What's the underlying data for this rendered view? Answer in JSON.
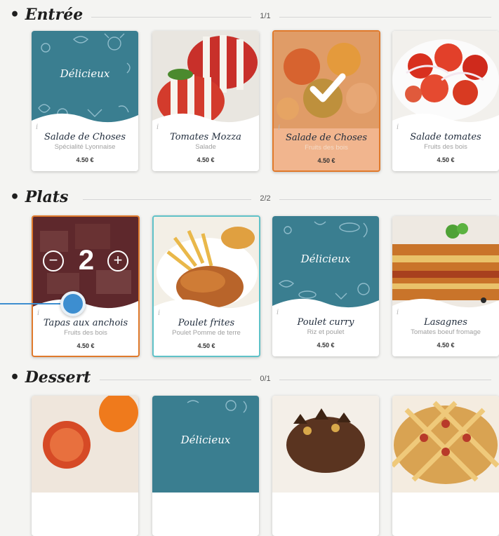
{
  "sections": [
    {
      "title": "• Entrée",
      "count": "1/1",
      "items": [
        {
          "name": "Salade de Choses",
          "sub": "Spécialité Lyonnaise",
          "price": "4.50 €",
          "image": "delicieux"
        },
        {
          "name": "Tomates Mozza",
          "sub": "Salade",
          "price": "4.50 €",
          "image": "tomato-mozza-photo"
        },
        {
          "name": "Salade de Choses",
          "sub": "Fruits des bois",
          "price": "4.50 €",
          "image": "salad-photo",
          "selected": true
        },
        {
          "name": "Salade tomates",
          "sub": "Fruits des bois",
          "price": "4.50 €",
          "image": "tomato-salad-photo"
        }
      ]
    },
    {
      "title": "• Plats",
      "count": "2/2",
      "items": [
        {
          "name": "Tapas aux anchois",
          "sub": "Fruits des bois",
          "price": "4.50 €",
          "image": "tapas-photo",
          "quantity": "2"
        },
        {
          "name": "Poulet frites",
          "sub": "Poulet Pomme de terre",
          "price": "4.50 €",
          "image": "chicken-fries-photo"
        },
        {
          "name": "Poulet curry",
          "sub": "Riz et poulet",
          "price": "4.50 €",
          "image": "delicieux"
        },
        {
          "name": "Lasagnes",
          "sub": "Tomates boeuf fromage",
          "price": "4.50 €",
          "image": "lasagna-photo"
        }
      ]
    },
    {
      "title": "• Dessert",
      "count": "0/1",
      "items": [
        {
          "image": "orange-dessert-photo"
        },
        {
          "image": "delicieux"
        },
        {
          "image": "chocolate-cake-photo"
        },
        {
          "image": "pie-photo"
        }
      ]
    }
  ],
  "placeholder_label": "Délicieux",
  "stepper": {
    "minus": "−",
    "plus": "+"
  },
  "info_glyph": "i",
  "colors": {
    "teal": "#3a7e90",
    "orange": "#e07a2c",
    "accent_blue": "#3d8ed0",
    "selected_teal_border": "#5fc2c8"
  }
}
